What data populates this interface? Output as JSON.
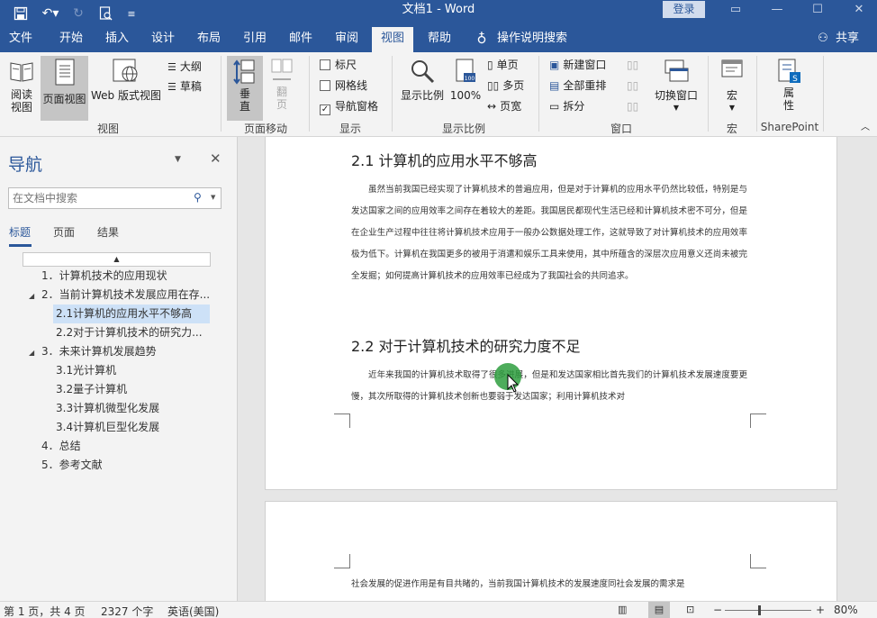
{
  "app": {
    "title": "文档1 - Word",
    "login": "登录"
  },
  "tabs": [
    "文件",
    "开始",
    "插入",
    "设计",
    "布局",
    "引用",
    "邮件",
    "审阅",
    "视图",
    "帮助"
  ],
  "tell_me": "操作说明搜索",
  "share": "共享",
  "ribbon": {
    "read_mode": "阅读\n视图",
    "print_layout": "页面视图",
    "web_layout": "Web 版式视图",
    "outline": "大纲",
    "draft": "草稿",
    "group_views": "视图",
    "vertical": "垂\n直",
    "side_by_side": "翻\n页",
    "group_page_move": "页面移动",
    "ruler": "标尺",
    "gridlines": "网格线",
    "nav_pane": "导航窗格",
    "group_show": "显示",
    "zoom": "显示比例",
    "zoom100": "100%",
    "one_page": "单页",
    "multi_page": "多页",
    "page_width": "页宽",
    "group_zoom": "显示比例",
    "new_window": "新建窗口",
    "arrange_all": "全部重排",
    "split": "拆分",
    "switch_windows": "切换窗口",
    "group_window": "窗口",
    "macros": "宏",
    "group_macros": "宏",
    "properties": "属\n性",
    "group_sharepoint": "SharePoint"
  },
  "nav": {
    "title": "导航",
    "search_placeholder": "在文档中搜索",
    "tabs": [
      "标题",
      "页面",
      "结果"
    ],
    "headings": [
      "1．计算机技术的应用现状",
      "2．当前计算机技术发展应用在存...",
      "2.1计算机的应用水平不够高",
      "2.2对于计算机技术的研究力...",
      "3．未来计算机发展趋势",
      "3.1光计算机",
      "3.2量子计算机",
      "3.3计算机微型化发展",
      "3.4计算机巨型化发展",
      "4．总结",
      "5．参考文献"
    ]
  },
  "doc": {
    "h21": "2.1 计算机的应用水平不够高",
    "p1": "虽然当前我国已经实现了计算机技术的普遍应用，但是对于计算机的应用水平仍然比较低，特别是与发达国家之间的应用效率之间存在着较大的差距。我国居民都现代生活已经和计算机技术密不可分，但是在企业生产过程中往往将计算机技术应用于一般办公数据处理工作，这就导致了对计算机技术的应用效率极为低下。计算机在我国更多的被用于消遣和娱乐工具来使用，其中所蕴含的深层次应用意义还尚未被完全发掘；如何提高计算机技术的应用效率已经成为了我国社会的共同追求。",
    "h22": "2.2 对于计算机技术的研究力度不足",
    "p2": "近年来我国的计算机技术取得了很多进展，但是和发达国家相比首先我们的计算机技术发展速度要更慢，其次所取得的计算机技术创新也要弱于发达国家；利用计算机技术对",
    "p3": "社会发展的促进作用是有目共睹的，当前我国计算机技术的发展速度同社会发展的需求是"
  },
  "status": {
    "page": "第 1 页，共 4 页",
    "words": "2327 个字",
    "lang": "英语(美国)",
    "zoom": "80%"
  },
  "colors": {
    "accent": "#2b579a",
    "selected": "#cde1f7",
    "cursor_highlight": "#2e9e3e"
  }
}
